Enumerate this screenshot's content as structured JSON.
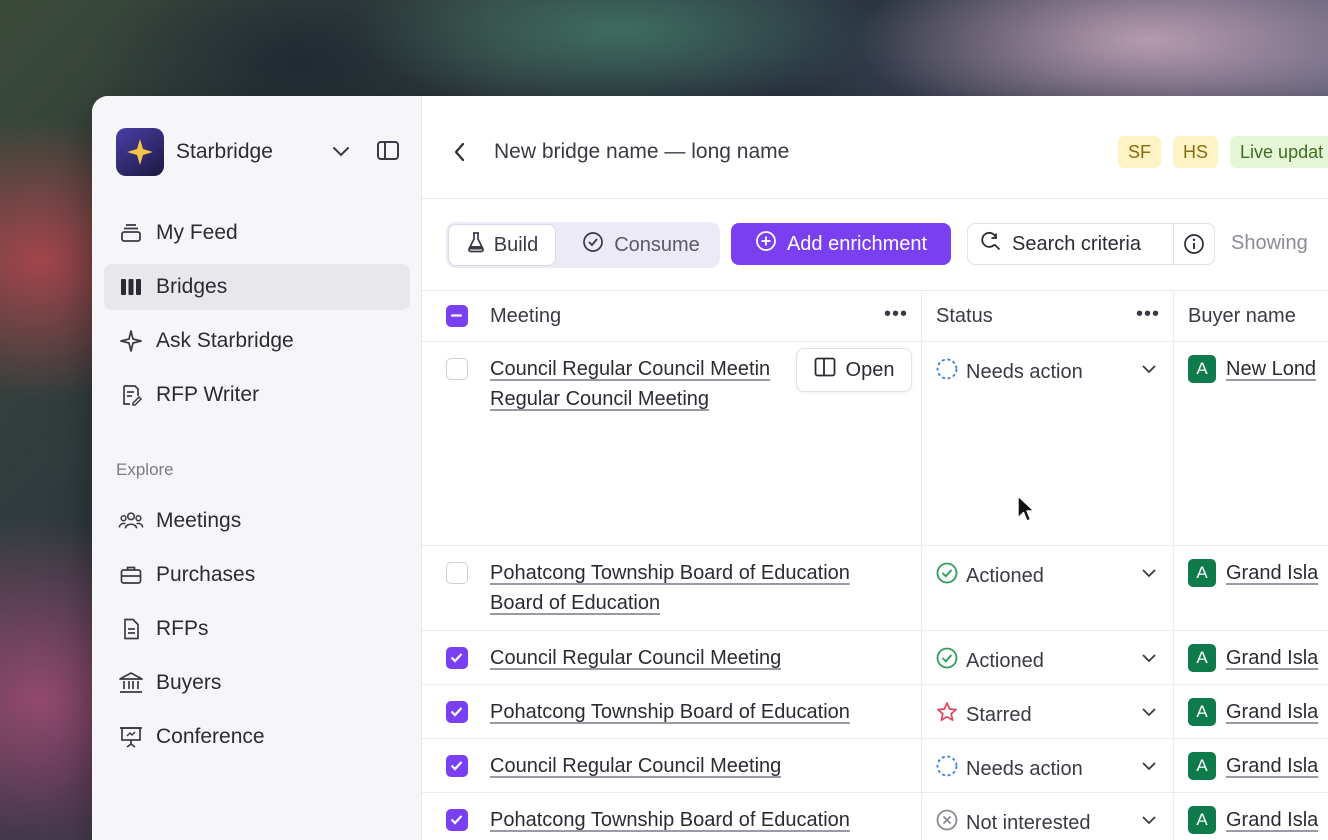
{
  "colors": {
    "accent": "#7b3ff2",
    "buyer_badge": "#0f7a4c"
  },
  "sidebar": {
    "brand": "Starbridge",
    "main_items": [
      {
        "label": "My Feed",
        "icon": "stack-icon"
      },
      {
        "label": "Bridges",
        "icon": "columns-icon"
      },
      {
        "label": "Ask Starbridge",
        "icon": "sparkle-icon"
      },
      {
        "label": "RFP Writer",
        "icon": "document-edit-icon"
      }
    ],
    "section_label": "Explore",
    "explore_items": [
      {
        "label": "Meetings",
        "icon": "people-icon"
      },
      {
        "label": "Purchases",
        "icon": "briefcase-icon"
      },
      {
        "label": "RFPs",
        "icon": "file-icon"
      },
      {
        "label": "Buyers",
        "icon": "bank-icon"
      },
      {
        "label": "Conference",
        "icon": "presentation-icon"
      }
    ]
  },
  "header": {
    "title": "New bridge name — long name",
    "badges": [
      "SF",
      "HS",
      "Live updat"
    ]
  },
  "toolbar": {
    "build": "Build",
    "consume": "Consume",
    "add_enrichment": "Add enrichment",
    "search_criteria": "Search criteria",
    "showing": "Showing"
  },
  "table": {
    "columns": [
      "Meeting",
      "Status",
      "Buyer name"
    ],
    "open_label": "Open",
    "rows": [
      {
        "checked": false,
        "meeting_line1": "Council Regular Council Meetin",
        "meeting_line2": "Regular Council Meeting",
        "status": "Needs action",
        "buyer": "New Lond"
      },
      {
        "checked": false,
        "meeting_line1": "Pohatcong Township Board of Education",
        "meeting_line2": "Board of Education",
        "status": "Actioned",
        "buyer": "Grand Isla"
      },
      {
        "checked": true,
        "meeting_line1": "Council Regular Council Meeting",
        "status": "Actioned",
        "buyer": "Grand Isla"
      },
      {
        "checked": true,
        "meeting_line1": "Pohatcong Township Board of Education",
        "status": "Starred",
        "buyer": "Grand Isla"
      },
      {
        "checked": true,
        "meeting_line1": "Council Regular Council Meeting",
        "status": "Needs action",
        "buyer": "Grand Isla"
      },
      {
        "checked": true,
        "meeting_line1": "Pohatcong Township Board of Education",
        "status": "Not interested",
        "buyer": "Grand Isla"
      }
    ],
    "buyer_badge_letter": "A"
  }
}
